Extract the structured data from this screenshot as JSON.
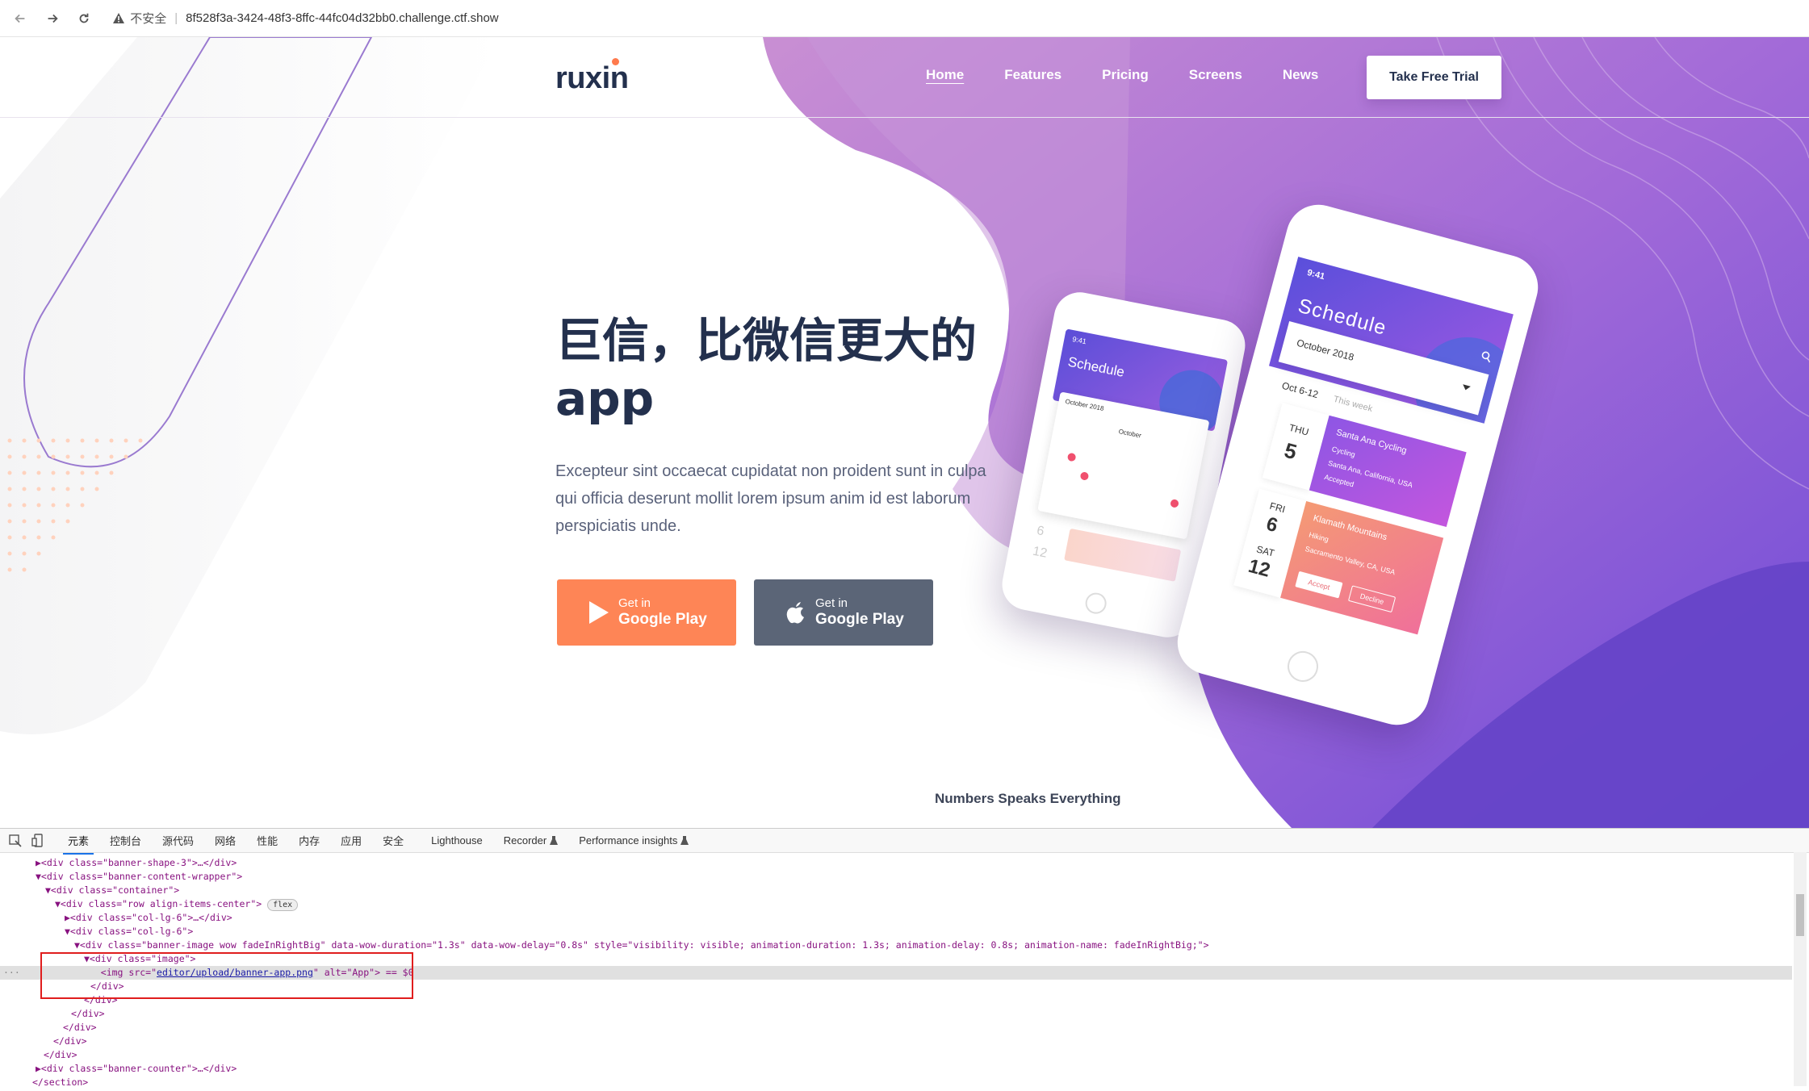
{
  "browser": {
    "security_label": "不安全",
    "url": "8f528f3a-3424-48f3-8ffc-44fc04d32bb0.challenge.ctf.show"
  },
  "site": {
    "logo": "ruxin",
    "nav": [
      {
        "label": "Home",
        "active": true
      },
      {
        "label": "Features"
      },
      {
        "label": "Pricing"
      },
      {
        "label": "Screens"
      },
      {
        "label": "News"
      }
    ],
    "cta": "Take Free Trial",
    "hero": {
      "title_line1": "巨信，比微信更大的",
      "title_line2": "app",
      "description_line1": "Excepteur sint occaecat cupidatat non proident sunt in culpa",
      "description_line2": "qui officia deserunt mollit lorem ipsum anim id est laborum",
      "description_line3": "perspiciatis unde."
    },
    "buttons": {
      "play_small": "Get in",
      "play_big": "Google Play",
      "apple_small": "Get in",
      "apple_big": "Google Play"
    },
    "phone_big": {
      "time": "9:41",
      "title": "Schedule",
      "month": "October 2018",
      "week": "Oct 6-12",
      "week_note": "This week",
      "card1_day": "THU",
      "card1_date": "5",
      "card1_title": "Santa Ana Cycling",
      "card1_activity": "Cycling",
      "card1_place": "Santa Ana, California, USA",
      "card1_status": "Accepted",
      "card2_day1": "FRI",
      "card2_date1": "6",
      "card2_day2": "SAT",
      "card2_date2": "12",
      "card2_title": "Klamath Mountains",
      "card2_activity": "Hiking",
      "card2_place": "Sacramento Valley, CA, USA",
      "accept": "Accept",
      "decline": "Decline"
    },
    "phone_small": {
      "time": "9:41",
      "title": "Schedule",
      "month": "October 2018",
      "cal_month": "October",
      "date1": "6",
      "date2": "12"
    },
    "numbers_heading": "Numbers Speaks Everything"
  },
  "devtools": {
    "tabs": [
      "元素",
      "控制台",
      "源代码",
      "网络",
      "性能",
      "内存",
      "应用",
      "安全",
      "Lighthouse",
      "Recorder",
      "Performance insights"
    ],
    "lines": [
      "▶<div class=\"banner-shape-3\">…</div>",
      "▼<div class=\"banner-content-wrapper\">",
      "▼<div class=\"container\">",
      "▼<div class=\"row align-items-center\">",
      "▶<div class=\"col-lg-6\">…</div>",
      "▼<div class=\"col-lg-6\">",
      "▼<div class=\"banner-image wow fadeInRightBig\" data-wow-duration=\"1.3s\" data-wow-delay=\"0.8s\" style=\"visibility: visible; animation-duration: 1.3s; animation-delay: 0.8s; animation-name: fadeInRightBig;\">",
      "▼<div class=\"image\">",
      "<img src=\"",
      "editor/upload/banner-app.png",
      "\" alt=\"App\"> == $0",
      "</div>",
      "</div>",
      "</div>",
      "</div>",
      "</div>",
      "</div>",
      "▶<div class=\"banner-counter\">…</div>",
      "</section>"
    ],
    "flex_badge": "flex"
  }
}
